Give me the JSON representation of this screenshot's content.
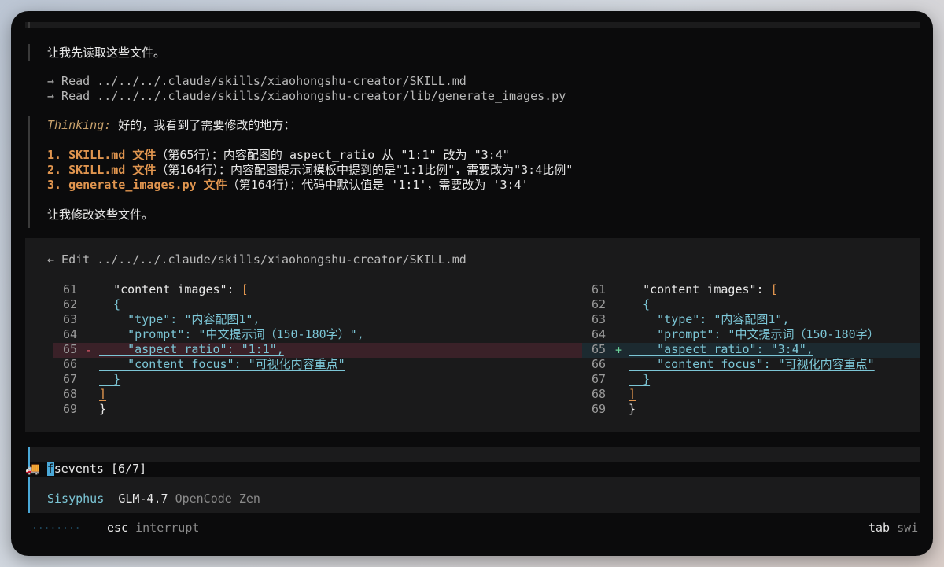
{
  "messages": {
    "intro": "让我先读取这些文件。",
    "read_1": "→ Read ../../../.claude/skills/xiaohongshu-creator/SKILL.md",
    "read_2": "→ Read ../../../.claude/skills/xiaohongshu-creator/lib/generate_images.py",
    "thinking_label": "Thinking:",
    "thinking_text": " 好的，我看到了需要修改的地方：",
    "items": [
      {
        "num": "1. ",
        "file": "SKILL.md 文件",
        "text": "（第65行）：内容配图的 aspect_ratio 从 \"1:1\" 改为 \"3:4\""
      },
      {
        "num": "2. ",
        "file": "SKILL.md 文件",
        "text": "（第164行）：内容配图提示词模板中提到的是\"1:1比例\"，需要改为\"3:4比例\""
      },
      {
        "num": "3. ",
        "file": "generate_images.py 文件",
        "text": "（第164行）：代码中默认值是 '1:1'，需要改为 '3:4'"
      }
    ],
    "outro": "让我修改这些文件。"
  },
  "edit": {
    "header": "← Edit ../../../.claude/skills/xiaohongshu-creator/SKILL.md",
    "line_numbers": [
      "61",
      "62",
      "63",
      "64",
      "65",
      "66",
      "67",
      "68",
      "69"
    ],
    "left": {
      "l61_key": "\"content_images\": ",
      "l61_brk": "[",
      "l62": "  {",
      "l63": "    \"type\": \"内容配图1\",",
      "l64": "    \"prompt\": \"中文提示词（150-180字）\",",
      "l65": "    \"aspect_ratio\": \"1:1\",",
      "l66": "    \"content_focus\": \"可视化内容重点\"",
      "l67": "  }",
      "l68": "]",
      "l69": "}",
      "marker": "-"
    },
    "right": {
      "l61_key": "\"content_images\": ",
      "l61_brk": "[",
      "l62": "  {",
      "l63": "    \"type\": \"内容配图1\",",
      "l64": "    \"prompt\": \"中文提示词（150-180字）",
      "l65": "    \"aspect_ratio\": \"3:4\",",
      "l66": "    \"content_focus\": \"可视化内容重点\"",
      "l67": "  }",
      "l68": "]",
      "l69": "}",
      "marker": "+"
    }
  },
  "status": {
    "truck_emoji": "🚚",
    "cursor_char": "f",
    "task": "sevents [6/7]",
    "agent": "Sisyphus",
    "model": "GLM-4.7",
    "provider": "OpenCode Zen",
    "dots": "········",
    "esc_key": "esc",
    "esc_label": "interrupt",
    "tab_key": "tab",
    "tab_label": "swi"
  }
}
